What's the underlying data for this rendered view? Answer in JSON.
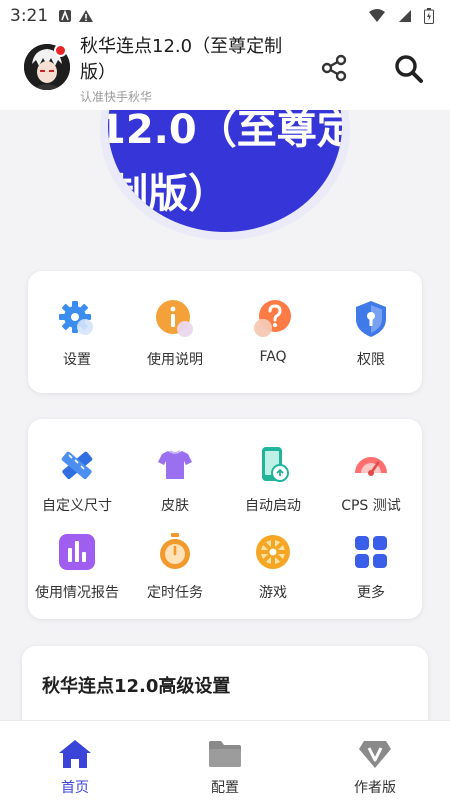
{
  "status_bar": {
    "time": "3:21"
  },
  "header": {
    "title": "秋华连点12.0（至尊定制版）",
    "subtitle": "认准快手秋华"
  },
  "banner": {
    "text_line1": "12.0（至尊定",
    "text_line2": "制版）"
  },
  "quick_menu": [
    {
      "label": "设置",
      "icon": "gear-icon"
    },
    {
      "label": "使用说明",
      "icon": "info-icon"
    },
    {
      "label": "FAQ",
      "icon": "question-icon"
    },
    {
      "label": "权限",
      "icon": "shield-icon"
    }
  ],
  "tools_menu": [
    {
      "label": "自定义尺寸",
      "icon": "ruler-icon"
    },
    {
      "label": "皮肤",
      "icon": "shirt-icon"
    },
    {
      "label": "自动启动",
      "icon": "phone-icon"
    },
    {
      "label": "CPS 测试",
      "icon": "speedometer-icon"
    },
    {
      "label": "使用情况报告",
      "icon": "bar-chart-icon"
    },
    {
      "label": "定时任务",
      "icon": "stopwatch-icon"
    },
    {
      "label": "游戏",
      "icon": "game-wheel-icon"
    },
    {
      "label": "更多",
      "icon": "grid-more-icon"
    }
  ],
  "advanced": {
    "title": "秋华连点12.0高级设置"
  },
  "bottom_nav": [
    {
      "label": "首页",
      "icon": "home-icon",
      "active": true
    },
    {
      "label": "配置",
      "icon": "folder-icon",
      "active": false
    },
    {
      "label": "作者版",
      "icon": "v-badge-icon",
      "active": false
    }
  ],
  "colors": {
    "accent": "#3a44d8",
    "banner": "#3535d8",
    "notification_dot": "#e8262a"
  }
}
